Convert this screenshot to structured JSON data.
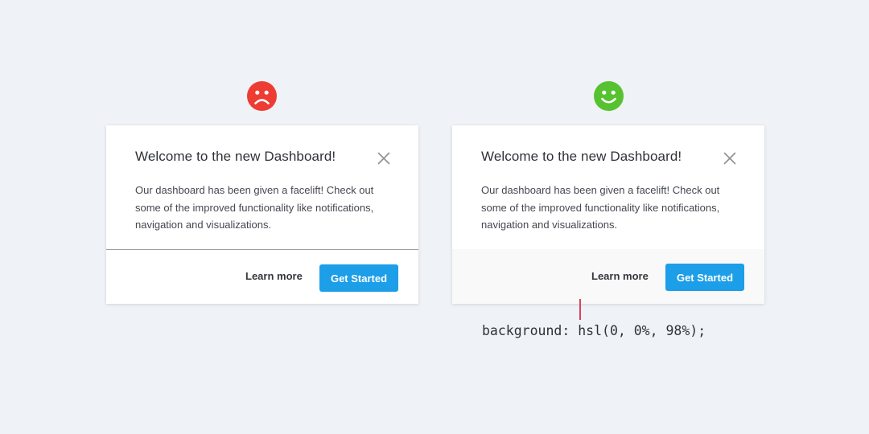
{
  "colors": {
    "background": "#eff2f6",
    "sad_face": "#ee3c33",
    "happy_face": "#56c22f",
    "primary_button": "#1d9ee8",
    "footer_good_background": "#f9f9f9",
    "divider_bad": "#9a9ea5",
    "annotation_line": "#e0405c"
  },
  "icons": {
    "bad_indicator": "sad-face-icon",
    "good_indicator": "happy-face-icon",
    "close": "close-icon"
  },
  "bad_example": {
    "title": "Welcome to the new Dashboard!",
    "body": "Our dashboard has been given a facelift! Check out some of the improved functionality like notifications, navigation and visualizations.",
    "secondary_button": "Learn more",
    "primary_button": "Get Started"
  },
  "good_example": {
    "title": "Welcome to the new Dashboard!",
    "body": "Our dashboard has been given a facelift! Check out some of the improved functionality like notifications, navigation and visualizations.",
    "secondary_button": "Learn more",
    "primary_button": "Get Started"
  },
  "annotation": {
    "code": "background: hsl(0, 0%, 98%);"
  }
}
